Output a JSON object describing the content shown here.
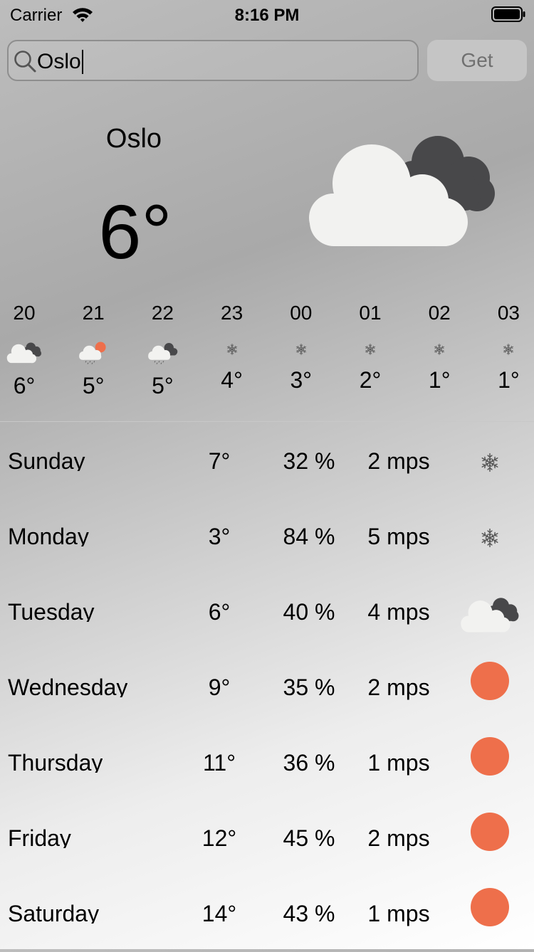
{
  "status_bar": {
    "carrier": "Carrier",
    "time": "8:16 PM"
  },
  "search": {
    "value": "Oslo",
    "button_label": "Get"
  },
  "current": {
    "city": "Oslo",
    "temperature": "6°",
    "icon": "cloud-icon"
  },
  "hourly": [
    {
      "time": "20",
      "temp": "6°",
      "icon": "cloud-icon"
    },
    {
      "time": "21",
      "temp": "5°",
      "icon": "rain-sun-icon"
    },
    {
      "time": "22",
      "temp": "5°",
      "icon": "rain-cloud-icon"
    },
    {
      "time": "23",
      "temp": "4°",
      "icon": "snowflake-icon"
    },
    {
      "time": "00",
      "temp": "3°",
      "icon": "snowflake-icon"
    },
    {
      "time": "01",
      "temp": "2°",
      "icon": "snowflake-icon"
    },
    {
      "time": "02",
      "temp": "1°",
      "icon": "snowflake-icon"
    },
    {
      "time": "03",
      "temp": "1°",
      "icon": "snowflake-icon"
    }
  ],
  "daily": [
    {
      "day": "Sunday",
      "temp": "7°",
      "humidity": "32 %",
      "wind": "2 mps",
      "icon": "snowflake-icon"
    },
    {
      "day": "Monday",
      "temp": "3°",
      "humidity": "84 %",
      "wind": "5 mps",
      "icon": "snowflake-icon"
    },
    {
      "day": "Tuesday",
      "temp": "6°",
      "humidity": "40 %",
      "wind": "4 mps",
      "icon": "cloud-icon"
    },
    {
      "day": "Wednesday",
      "temp": "9°",
      "humidity": "35 %",
      "wind": "2 mps",
      "icon": "sun-icon"
    },
    {
      "day": "Thursday",
      "temp": "11°",
      "humidity": "36 %",
      "wind": "1 mps",
      "icon": "sun-icon"
    },
    {
      "day": "Friday",
      "temp": "12°",
      "humidity": "45 %",
      "wind": "2 mps",
      "icon": "sun-icon"
    },
    {
      "day": "Saturday",
      "temp": "14°",
      "humidity": "43 %",
      "wind": "1 mps",
      "icon": "sun-icon"
    }
  ],
  "colors": {
    "sun": "#ee6f4b",
    "dark_cloud": "#48484a",
    "light_cloud": "#f2f2f0",
    "snow": "#555555"
  }
}
